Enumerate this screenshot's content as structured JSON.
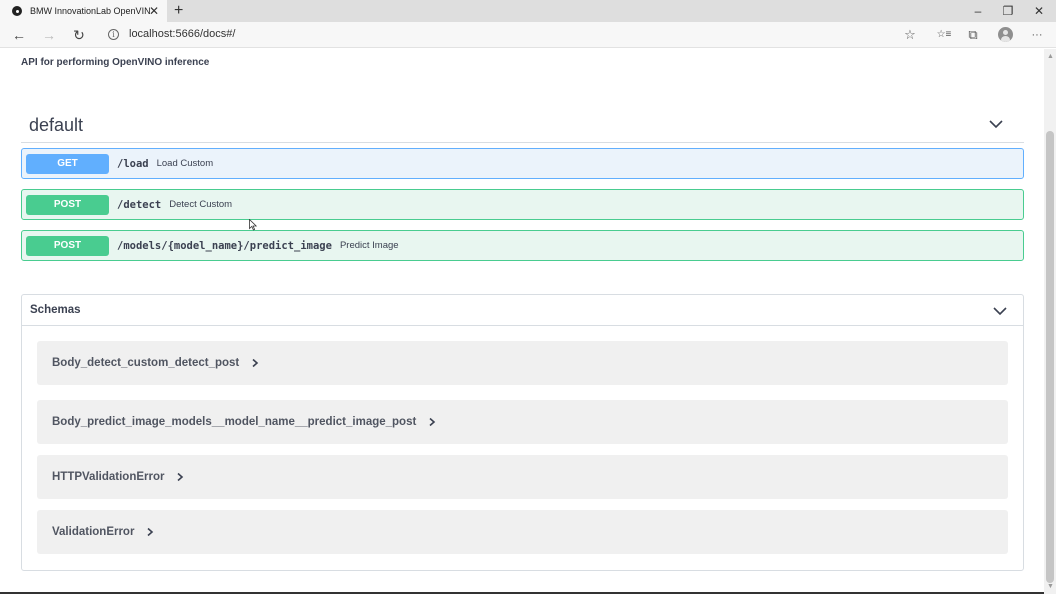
{
  "browser": {
    "tab_title": "BMW InnovationLab OpenVINO",
    "tab_close": "✕",
    "new_tab": "+",
    "minimize": "–",
    "restore": "❐",
    "close": "✕",
    "url": "localhost:5666/docs#/",
    "back": "←",
    "forward": "→",
    "refresh": "↻",
    "info": "i",
    "favorite": "☆",
    "favorites": "☆≡",
    "collections": "⧉",
    "more": "···"
  },
  "page": {
    "description": "API for performing OpenVINO inference"
  },
  "tag": {
    "title": "default"
  },
  "operations": [
    {
      "method": "GET",
      "path": "/load",
      "summary": "Load Custom"
    },
    {
      "method": "POST",
      "path": "/detect",
      "summary": "Detect Custom"
    },
    {
      "method": "POST",
      "path": "/models/{model_name}/predict_image",
      "summary": "Predict Image"
    }
  ],
  "schemas": {
    "title": "Schemas",
    "models": [
      {
        "name": "Body_detect_custom_detect_post"
      },
      {
        "name": "Body_predict_image_models__model_name__predict_image_post"
      },
      {
        "name": "HTTPValidationError"
      },
      {
        "name": "ValidationError"
      }
    ]
  },
  "colors": {
    "get": "#61affe",
    "post": "#49cc90",
    "text": "#3b4151"
  },
  "icons": {
    "tag_chevron": "chevron-down-icon",
    "schemas_chevron": "chevron-down-icon",
    "model_arrow": "chevron-right-icon"
  }
}
